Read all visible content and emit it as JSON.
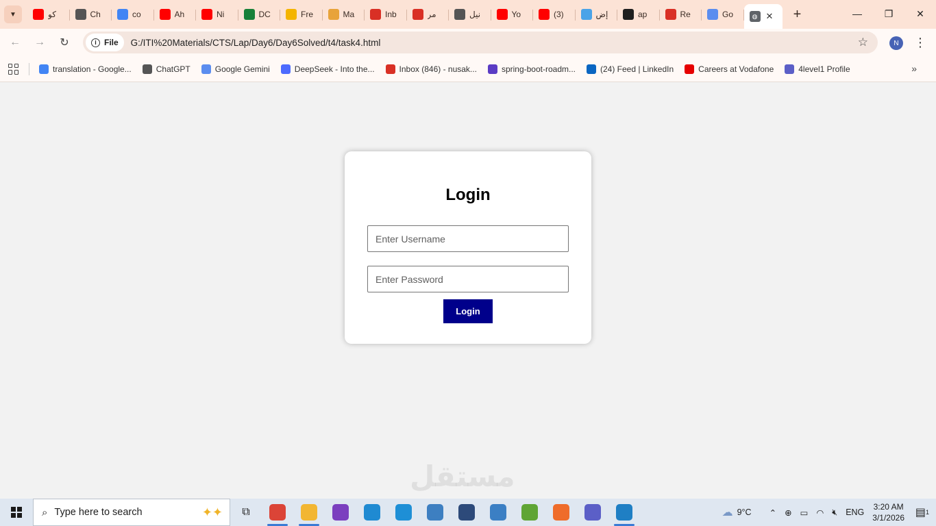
{
  "browser": {
    "tabs": [
      {
        "title": "كو",
        "icon": "youtube-icon",
        "color": "#ff0000"
      },
      {
        "title": "Ch",
        "icon": "chatgpt-icon",
        "color": "#555555"
      },
      {
        "title": "co",
        "icon": "google-icon",
        "color": "#4285f4"
      },
      {
        "title": "Ah",
        "icon": "youtube-icon",
        "color": "#ff0000"
      },
      {
        "title": "Ni",
        "icon": "youtube-icon",
        "color": "#ff0000"
      },
      {
        "title": "DC",
        "icon": "sheets-icon",
        "color": "#188038"
      },
      {
        "title": "Fre",
        "icon": "drive-icon",
        "color": "#f4b400"
      },
      {
        "title": "Ma",
        "icon": "person-icon",
        "color": "#e8a33a"
      },
      {
        "title": "Inb",
        "icon": "gmail-icon",
        "color": "#d93025"
      },
      {
        "title": "مر",
        "icon": "gmail-icon",
        "color": "#d93025"
      },
      {
        "title": "نيل",
        "icon": "chatgpt-icon",
        "color": "#555555"
      },
      {
        "title": "Yo",
        "icon": "youtube-icon",
        "color": "#ff0000"
      },
      {
        "title": "(3)",
        "icon": "youtube-icon",
        "color": "#ff0000"
      },
      {
        "title": "إض",
        "icon": "circle-icon",
        "color": "#4aa3e8"
      },
      {
        "title": "ap",
        "icon": "github-icon",
        "color": "#1f1f1f"
      },
      {
        "title": "Re",
        "icon": "gmail-icon",
        "color": "#d93025"
      },
      {
        "title": "Go",
        "icon": "gemini-icon",
        "color": "#5b8def"
      }
    ],
    "active_tab_icon": "globe-icon",
    "address": {
      "scheme_label": "File",
      "url": "G:/ITI%20Materials/CTS/Lap/Day6/Day6Solved/t4/task4.html"
    },
    "profile_initial": "N",
    "bookmarks": [
      {
        "label": "translation - Google...",
        "icon": "google-icon",
        "color": "#4285f4"
      },
      {
        "label": "ChatGPT",
        "icon": "chatgpt-icon",
        "color": "#555555"
      },
      {
        "label": "Google Gemini",
        "icon": "gemini-icon",
        "color": "#5b8def"
      },
      {
        "label": "DeepSeek - Into the...",
        "icon": "deepseek-icon",
        "color": "#4d6bfe"
      },
      {
        "label": "Inbox (846) - nusak...",
        "icon": "gmail-icon",
        "color": "#d93025"
      },
      {
        "label": "spring-boot-roadm...",
        "icon": "roadmap-icon",
        "color": "#5b3cc4"
      },
      {
        "label": "(24) Feed | LinkedIn",
        "icon": "linkedin-icon",
        "color": "#0a66c2"
      },
      {
        "label": "Careers at Vodafone",
        "icon": "vodafone-icon",
        "color": "#e60000"
      },
      {
        "label": "4level1 Profile",
        "icon": "document-icon",
        "color": "#5b5fc7"
      }
    ]
  },
  "login": {
    "title": "Login",
    "username_placeholder": "Enter Username",
    "password_placeholder": "Enter Password",
    "submit_label": "Login",
    "button_color": "#00008b"
  },
  "taskbar": {
    "search_placeholder": "Type here to search",
    "weather": "9°C",
    "language": "ENG",
    "time": "3:20 AM",
    "date": "3/1/2026",
    "notification_count": "1",
    "apps": [
      {
        "name": "chrome",
        "icon": "chrome-icon",
        "color": "#db4437",
        "active": true
      },
      {
        "name": "file-explorer",
        "icon": "folder-icon",
        "color": "#f2b632",
        "active": true
      },
      {
        "name": "visual-studio",
        "icon": "visual-studio-icon",
        "color": "#7b3fbf",
        "active": false
      },
      {
        "name": "vscode",
        "icon": "vscode-icon",
        "color": "#1f8ad2",
        "active": false
      },
      {
        "name": "edge",
        "icon": "edge-icon",
        "color": "#1e8fd6",
        "active": false
      },
      {
        "name": "sql-server",
        "icon": "database-icon",
        "color": "#3d7fc1",
        "active": false
      },
      {
        "name": "app-1",
        "icon": "app-icon",
        "color": "#2d4a7a",
        "active": false
      },
      {
        "name": "app-2",
        "icon": "castle-icon",
        "color": "#3b7fc4",
        "active": false
      },
      {
        "name": "spring",
        "icon": "spring-icon",
        "color": "#5fa535",
        "active": false
      },
      {
        "name": "postman",
        "icon": "postman-icon",
        "color": "#ef6c2a",
        "active": false
      },
      {
        "name": "teams",
        "icon": "teams-icon",
        "color": "#5b5fc7",
        "active": false
      },
      {
        "name": "photos",
        "icon": "photos-icon",
        "color": "#1f7fc4",
        "active": true
      }
    ]
  }
}
